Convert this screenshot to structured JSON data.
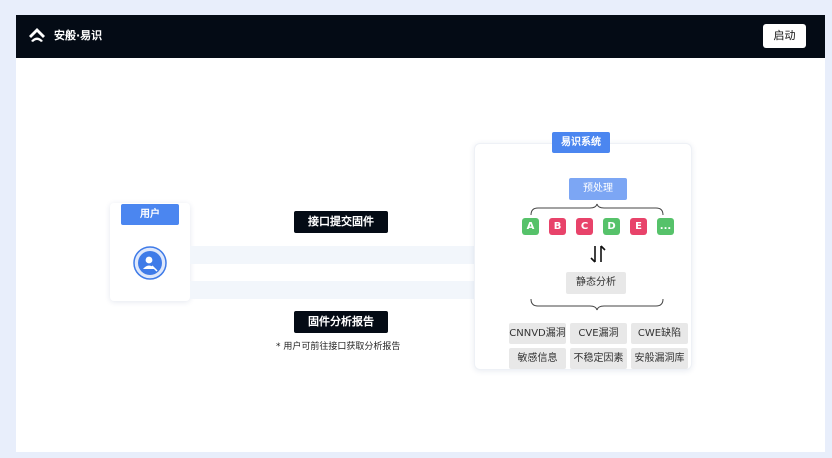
{
  "header": {
    "brand": "安般·易识",
    "start_label": "启动"
  },
  "user": {
    "tag": "用户"
  },
  "flow": {
    "submit_label": "接口提交固件",
    "report_label": "固件分析报告",
    "note": "* 用户可前往接口获取分析报告"
  },
  "system": {
    "title": "易识系统",
    "preprocess": "预处理",
    "chips": [
      {
        "label": "A",
        "color": "#56c26a"
      },
      {
        "label": "B",
        "color": "#e8436a"
      },
      {
        "label": "C",
        "color": "#e8436a"
      },
      {
        "label": "D",
        "color": "#56c26a"
      },
      {
        "label": "E",
        "color": "#e8436a"
      },
      {
        "label": "...",
        "color": "#56c26a"
      }
    ],
    "static_analysis": "静态分析",
    "results": [
      "CNNVD漏洞",
      "CVE漏洞",
      "CWE缺陷",
      "敏感信息",
      "不稳定因素",
      "安般漏洞库"
    ]
  },
  "colors": {
    "accent": "#4b86f0",
    "topbar": "#040b15",
    "background": "#e8eefb"
  }
}
